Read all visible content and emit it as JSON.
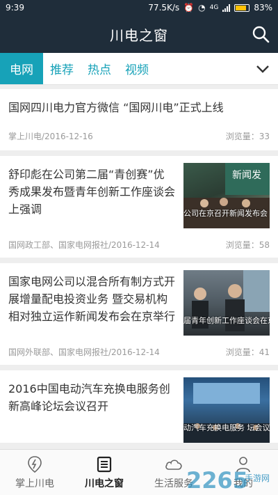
{
  "status": {
    "time": "9:39",
    "speed": "77.5K/s",
    "net": "4G",
    "battery": "83%",
    "battery_level": 0.83
  },
  "header": {
    "title": "川电之窗",
    "search_icon": "search-icon"
  },
  "tabs": [
    {
      "label": "电网"
    },
    {
      "label": "推荐"
    },
    {
      "label": "热点"
    },
    {
      "label": "视频"
    }
  ],
  "articles": [
    {
      "title": "国网四川电力官方微信 “国网川电”正式上线",
      "source": "掌上川电/2016-12-16",
      "views": "浏览量：33"
    },
    {
      "title": "舒印彪在公司第二届“青创赛”优秀成果发布暨青年创新工作座谈会上强调",
      "source": "国网政工部、国家电网报社/2016-12-14",
      "views": "浏览量：58",
      "thumb_caption": "公司在京召开新闻发布会"
    },
    {
      "title": "国家电网公司以混合所有制方式开展增量配电投资业务 暨交易机构相对独立运作新闻发布会在京举行",
      "source": "国网外联部、国家电网报社/2016-12-14",
      "views": "浏览量：41",
      "thumb_caption": "届青年创新工作座谈会在京举行"
    },
    {
      "title": "2016中国电动汽车充换电服务创新高峰论坛会议召开",
      "thumb_caption": "动汽车充换电服务 坛会议召开"
    }
  ],
  "nav": [
    {
      "label": "掌上川电",
      "icon": "lightning-pin-icon"
    },
    {
      "label": "川电之窗",
      "icon": "news-icon"
    },
    {
      "label": "生活服务",
      "icon": "cloud-icon"
    },
    {
      "label": "我的",
      "icon": "person-icon"
    }
  ],
  "watermark": "2265 手游网",
  "colors": {
    "header_bg": "#1f2d3a",
    "accent": "#17a2b8"
  }
}
